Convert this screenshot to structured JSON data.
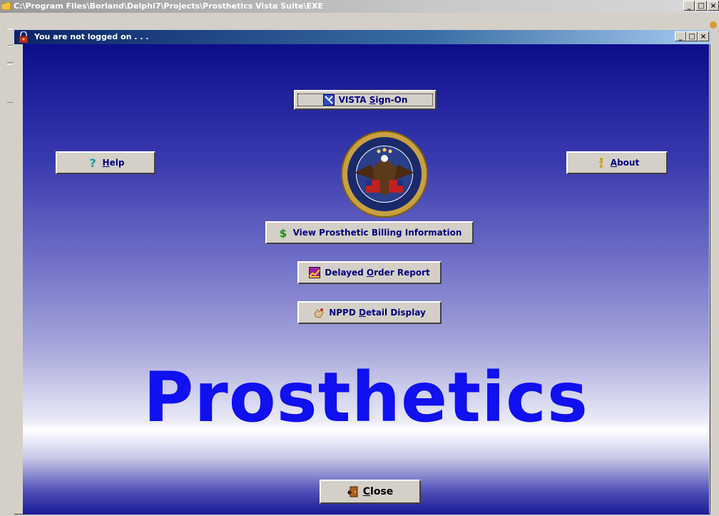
{
  "app_window": {
    "title": "C:\\Program Files\\Borland\\Delphi7\\Projects\\Prosthetics Vista Suite\\EXE",
    "controls": [
      "_",
      "□",
      "×"
    ]
  },
  "child_window": {
    "title": "You are not logged on . . .",
    "controls": [
      "_",
      "□",
      "×"
    ]
  },
  "buttons": {
    "signon": {
      "pre": "VISTA ",
      "accel": "S",
      "post": "ign-On"
    },
    "help": {
      "accel": "H",
      "post": "elp"
    },
    "about": {
      "accel": "A",
      "post": "bout"
    },
    "billing": {
      "label": "View Prosthetic Billing Information"
    },
    "delayed": {
      "pre": "Delayed ",
      "accel": "O",
      "post": "rder Report"
    },
    "nppd": {
      "pre": "NPPD ",
      "accel": "D",
      "post": "etail Display"
    },
    "close": {
      "accel": "C",
      "post": "lose"
    }
  },
  "banner": {
    "text": "Prosthetics"
  },
  "colors": {
    "banner": "#1010f0",
    "button_text": "#000080"
  }
}
